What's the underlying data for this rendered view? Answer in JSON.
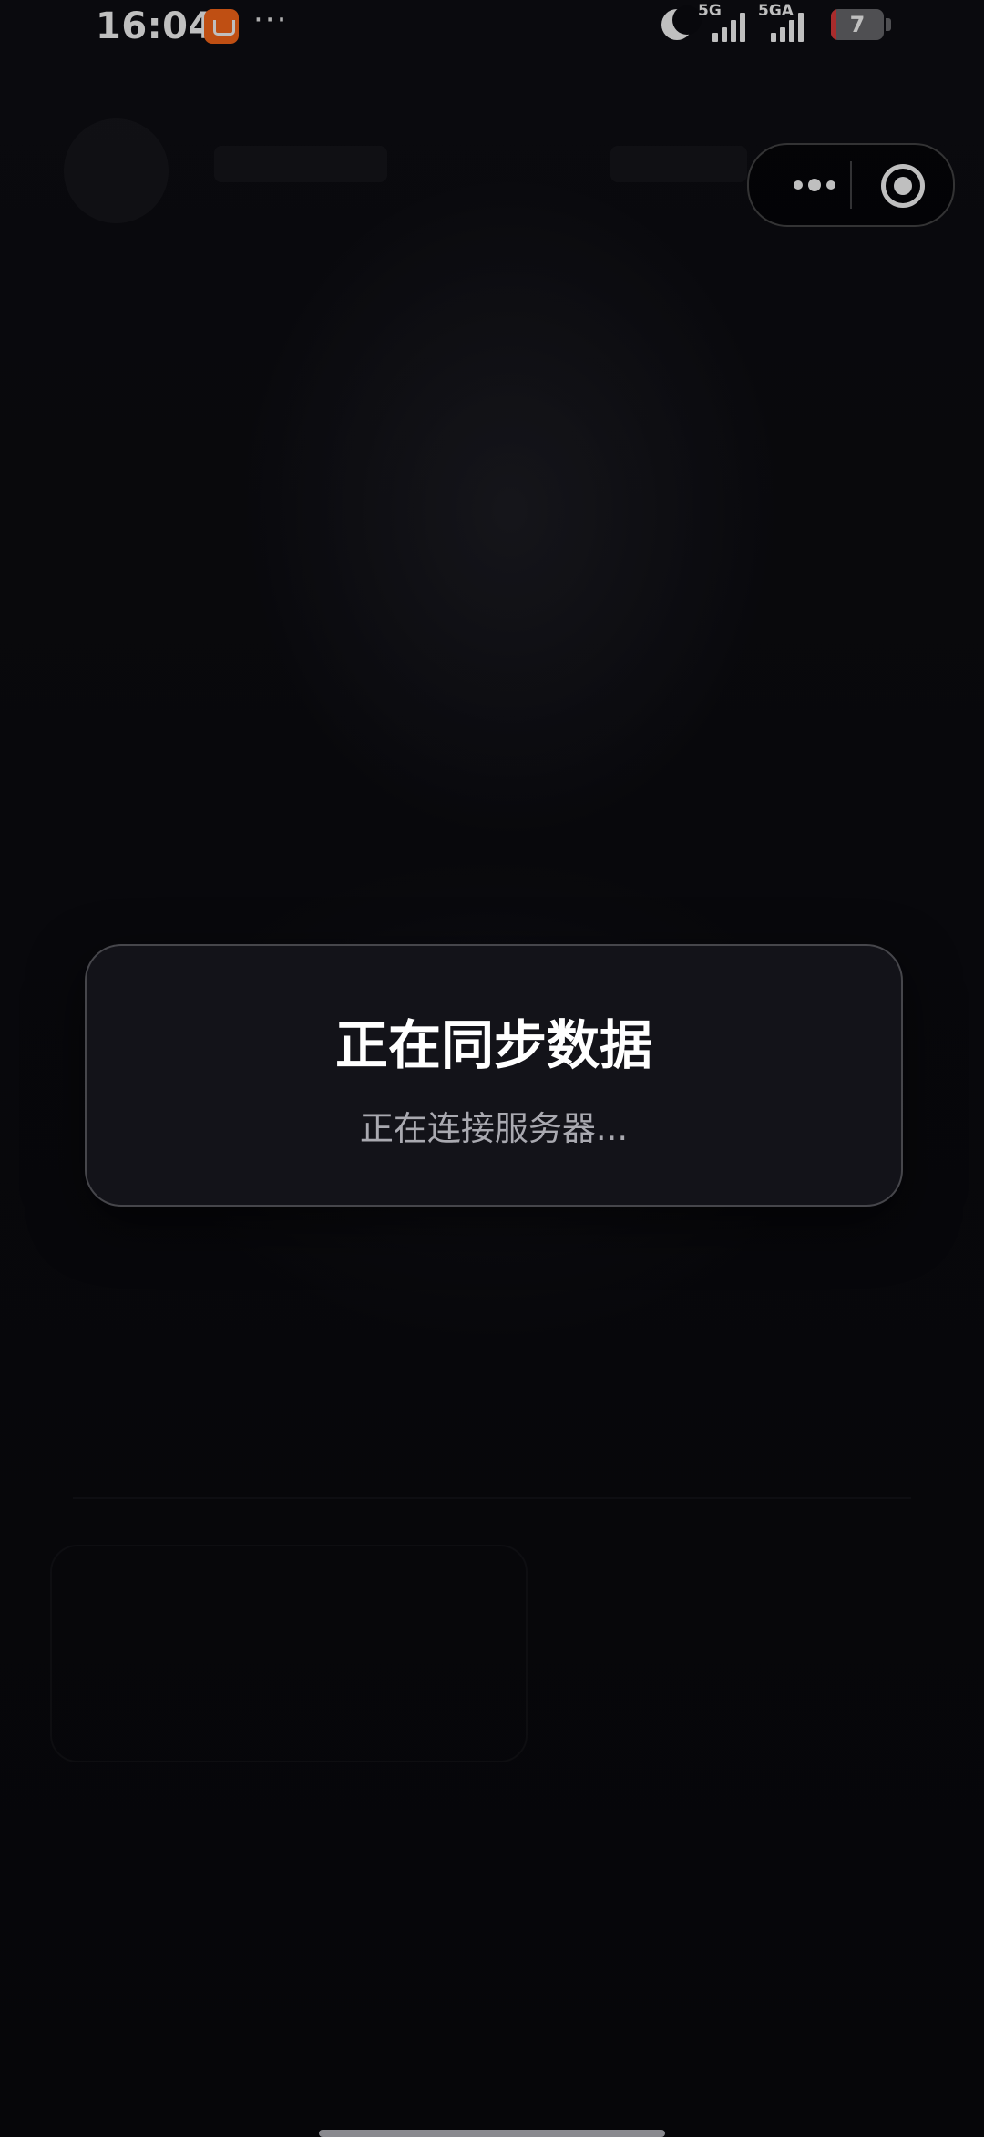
{
  "status_bar": {
    "time": "16:04",
    "more": "···",
    "network_1": "5G",
    "network_2": "5GA",
    "battery": "7",
    "battery_color": "#6a6a6e"
  },
  "capsule": {
    "more_icon": "more-dots-icon",
    "close_icon": "close-target-icon"
  },
  "modal": {
    "title": "正在同步数据",
    "subtitle": "正在连接服务器..."
  },
  "colors": {
    "background": "#0b0b10",
    "modal_bg": "#131319",
    "modal_text": "#ffffff",
    "modal_subtext": "#a9a9b0"
  }
}
